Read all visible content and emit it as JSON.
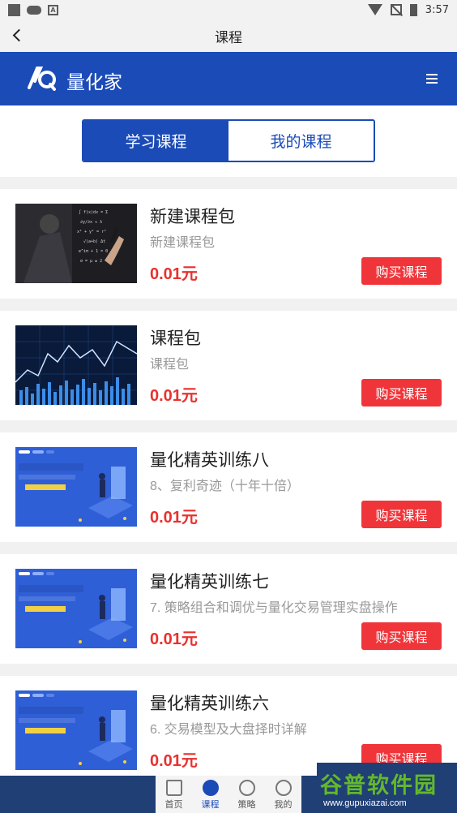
{
  "status_bar": {
    "time": "3:57"
  },
  "header": {
    "title": "课程"
  },
  "brand": {
    "name": "量化家"
  },
  "tabs": [
    {
      "label": "学习课程",
      "active": true
    },
    {
      "label": "我的课程",
      "active": false
    }
  ],
  "courses": [
    {
      "title": "新建课程包",
      "subtitle": "新建课程包",
      "price": "0.01元",
      "button": "购买课程",
      "thumb": "hand-formula"
    },
    {
      "title": "课程包",
      "subtitle": "课程包",
      "price": "0.01元",
      "button": "购买课程",
      "thumb": "stock-chart"
    },
    {
      "title": "量化精英训练八",
      "subtitle": "8、复利奇迹（十年十倍）",
      "price": "0.01元",
      "button": "购买课程",
      "thumb": "training-banner"
    },
    {
      "title": "量化精英训练七",
      "subtitle": "7. 策略组合和调优与量化交易管理实盘操作",
      "price": "0.01元",
      "button": "购买课程",
      "thumb": "training-banner"
    },
    {
      "title": "量化精英训练六",
      "subtitle": "6. 交易模型及大盘择时详解",
      "price": "0.01元",
      "button": "购买课程",
      "thumb": "training-banner"
    }
  ],
  "bottom_nav": [
    {
      "label": "首页",
      "icon": "home-icon",
      "active": false
    },
    {
      "label": "课程",
      "icon": "course-icon",
      "active": true
    },
    {
      "label": "策略",
      "icon": "compass-icon",
      "active": false
    },
    {
      "label": "我的",
      "icon": "profile-icon",
      "active": false
    }
  ],
  "watermark": {
    "title": "谷普软件园",
    "url": "www.gupuxiazai.com"
  },
  "colors": {
    "brand_blue": "#1b4bb7",
    "price_red": "#e8312f",
    "buy_button": "#f0353a"
  }
}
